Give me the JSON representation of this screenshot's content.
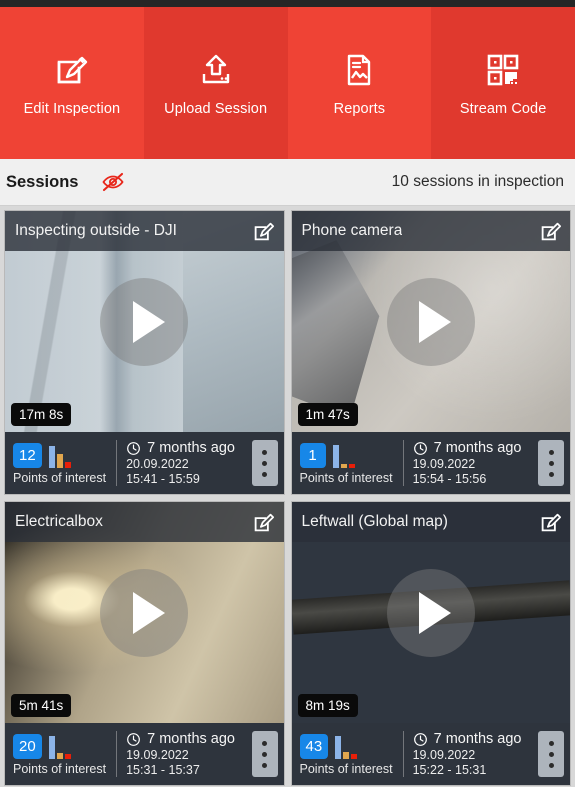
{
  "toolbar": {
    "buttons": [
      {
        "label": "Edit Inspection",
        "icon": "edit-pencil-square-icon"
      },
      {
        "label": "Upload Session",
        "icon": "upload-arrow-icon"
      },
      {
        "label": "Reports",
        "icon": "document-chart-icon"
      },
      {
        "label": "Stream Code",
        "icon": "qr-code-icon"
      }
    ],
    "background_color": "#ef4335"
  },
  "sessions_bar": {
    "title": "Sessions",
    "visibility_icon": "eye-off-icon",
    "visibility_icon_color": "#e8261a",
    "count_text": "10 sessions in inspection"
  },
  "sessions": [
    {
      "title": "Inspecting outside - DJI",
      "duration": "17m 8s",
      "points_of_interest": "12",
      "poi_label": "Points of interest",
      "time_ago": "7 months ago",
      "date": "20.09.2022",
      "time_range": "15:41 - 15:59",
      "chart": {
        "blue": 22,
        "orange": 14,
        "red": 6
      }
    },
    {
      "title": "Phone camera",
      "duration": "1m 47s",
      "points_of_interest": "1",
      "poi_label": "Points of interest",
      "time_ago": "7 months ago",
      "date": "19.09.2022",
      "time_range": "15:54 - 15:56",
      "chart": {
        "blue": 23,
        "orange": 4,
        "red": 4
      }
    },
    {
      "title": "Electricalbox",
      "duration": "5m 41s",
      "points_of_interest": "20",
      "poi_label": "Points of interest",
      "time_ago": "7 months ago",
      "date": "19.09.2022",
      "time_range": "15:31 - 15:37",
      "chart": {
        "blue": 23,
        "orange": 6,
        "red": 5
      }
    },
    {
      "title": "Leftwall (Global map)",
      "duration": "8m 19s",
      "points_of_interest": "43",
      "poi_label": "Points of interest",
      "time_ago": "7 months ago",
      "date": "19.09.2022",
      "time_range": "15:22 - 15:31",
      "chart": {
        "blue": 23,
        "orange": 7,
        "red": 5
      }
    }
  ],
  "colors": {
    "accent_red": "#ef4335",
    "badge_blue": "#1787e8",
    "card_dark": "#2e343c",
    "page_bg": "#d8d8d8"
  }
}
